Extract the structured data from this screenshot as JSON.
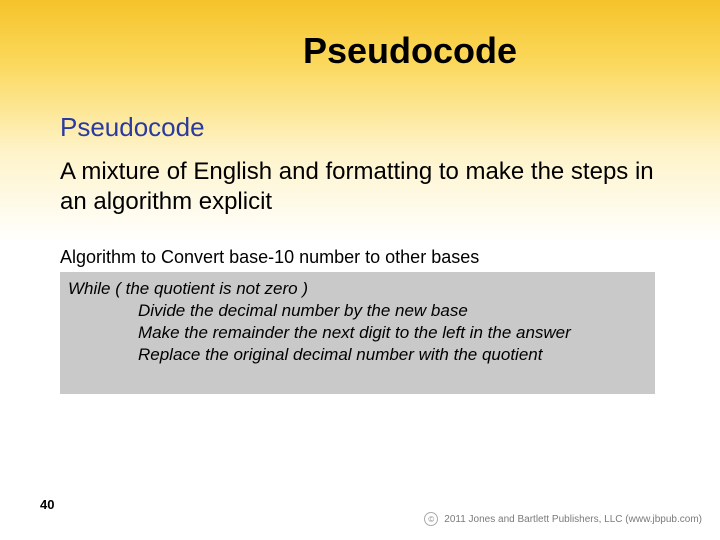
{
  "slide": {
    "title": "Pseudocode",
    "subtitle": "Pseudocode",
    "body": "A mixture of English and formatting to make the steps in an algorithm explicit",
    "algo_label": "Algorithm to Convert base-10 number to other bases",
    "code": {
      "line1": "While ( the quotient is not zero )",
      "line2": "Divide the decimal number by the new base",
      "line3": "Make the remainder the next digit to the left in the answer",
      "line4": "Replace the original decimal number with the quotient"
    },
    "page_number": "40",
    "footer": {
      "copyright_symbol": "©",
      "text": "2011 Jones and Bartlett Publishers, LLC (www.jbpub.com)"
    }
  }
}
